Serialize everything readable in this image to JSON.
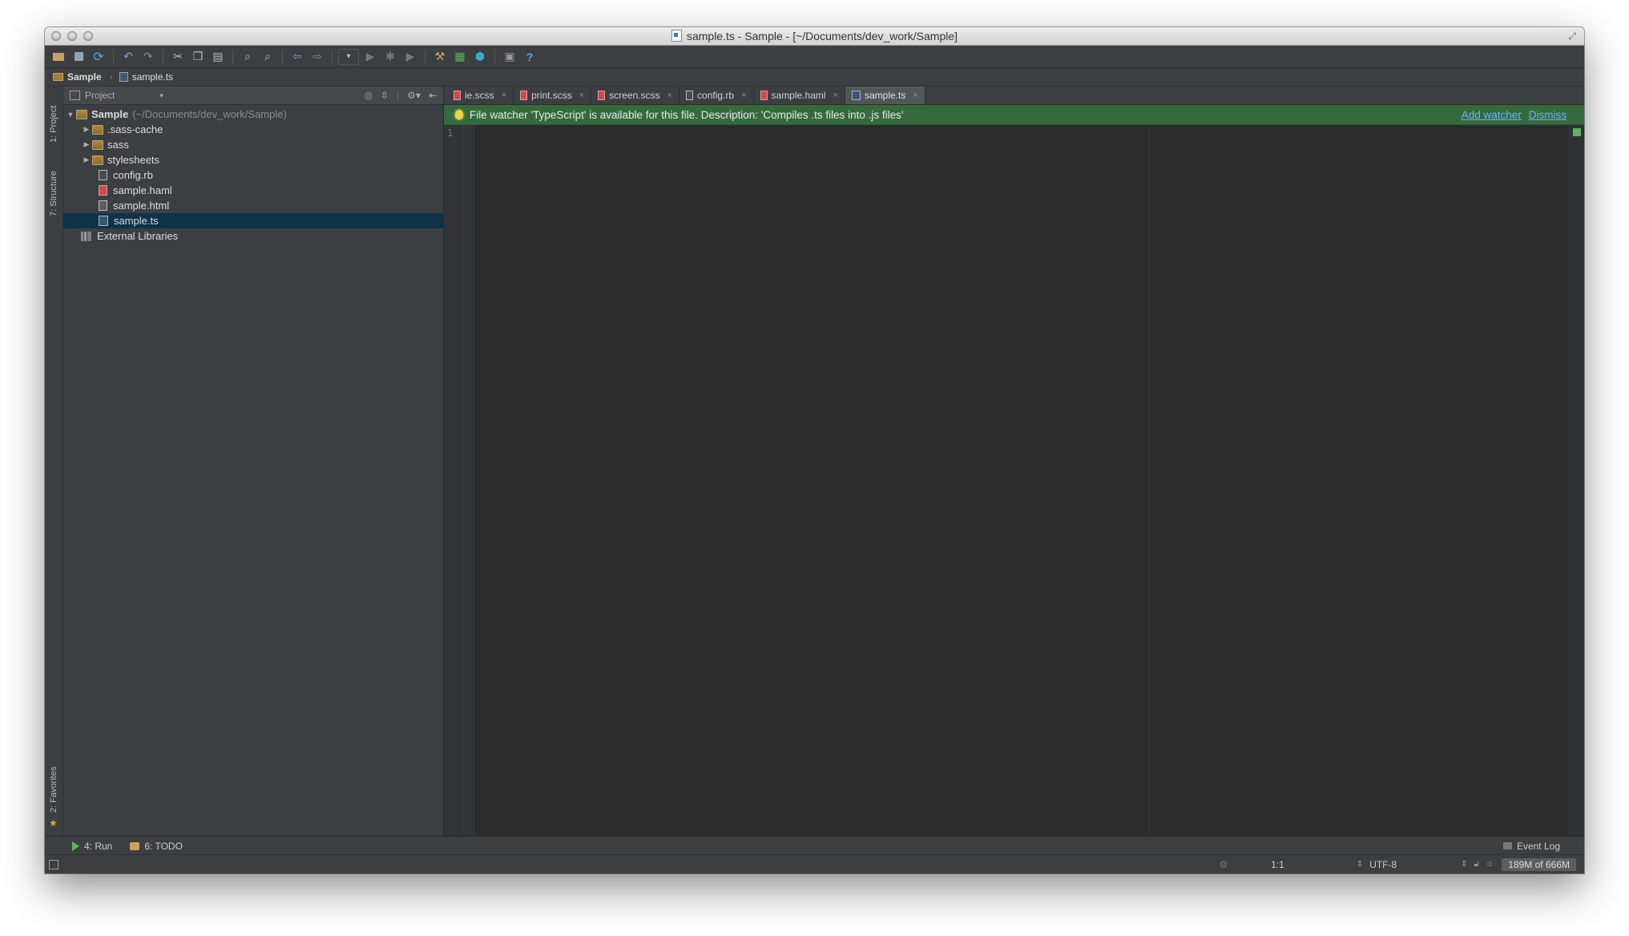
{
  "window": {
    "title": "sample.ts - Sample - [~/Documents/dev_work/Sample]"
  },
  "breadcrumbs": [
    "Sample",
    "sample.ts"
  ],
  "side_tabs": {
    "project": "1: Project",
    "structure": "7: Structure",
    "favorites": "2: Favorites"
  },
  "project_panel": {
    "header": "Project",
    "root": {
      "name": "Sample",
      "path": "(~/Documents/dev_work/Sample)"
    },
    "folders": [
      ".sass-cache",
      "sass",
      "stylesheets"
    ],
    "files": [
      "config.rb",
      "sample.haml",
      "sample.html",
      "sample.ts"
    ],
    "external": "External Libraries"
  },
  "tabs": [
    "ie.scss",
    "print.scss",
    "screen.scss",
    "config.rb",
    "sample.haml",
    "sample.ts"
  ],
  "banner": {
    "message": "File watcher 'TypeScript' is available for this file. Description: 'Compiles .ts files into .js files'",
    "add_watcher": "Add watcher",
    "dismiss": "Dismiss"
  },
  "editor": {
    "line_number": "1"
  },
  "tool_windows": {
    "run": "4: Run",
    "todo": "6: TODO",
    "event_log": "Event Log"
  },
  "status_bar": {
    "position": "1:1",
    "encoding": "UTF-8",
    "memory": "189M of 666M"
  },
  "colors": {
    "background": "#3c3f41",
    "editor": "#2b2b2b",
    "banner": "#356a3d",
    "selection": "#0d3349",
    "link": "#6fb2ee"
  }
}
